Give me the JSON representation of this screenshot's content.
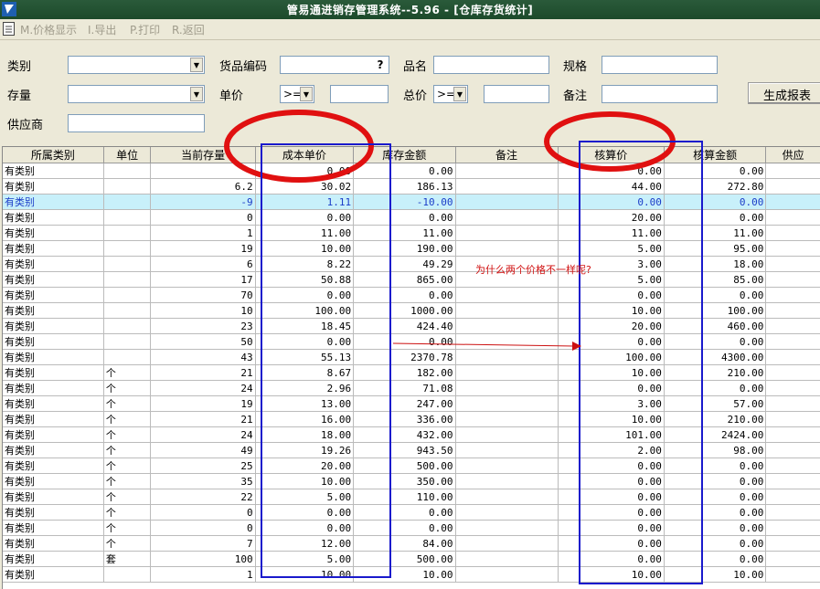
{
  "window": {
    "title": "管易通进销存管理系统--5.96 - [仓库存货统计]"
  },
  "toolbar": {
    "items": [
      {
        "label": "M.价格显示"
      },
      {
        "label": "I.导出"
      },
      {
        "label": "P.打印"
      },
      {
        "label": "R.返回"
      }
    ]
  },
  "form": {
    "category_label": "类别",
    "code_label": "货品编码",
    "code_button": "?",
    "name_label": "品名",
    "spec_label": "规格",
    "stock_label": "存量",
    "price_label": "单价",
    "price_op": ">=",
    "total_label": "总价",
    "total_op": ">=",
    "note_label": "备注",
    "supplier_label": "供应商",
    "generate_button": "生成报表"
  },
  "table": {
    "columns": [
      "所属类别",
      "单位",
      "当前存量",
      "成本单价",
      "库存金额",
      "备注",
      "核算价",
      "核算金额",
      "供应"
    ],
    "rows": [
      [
        "有类别",
        "",
        "",
        "0.00",
        "0.00",
        "",
        "0.00",
        "0.00",
        ""
      ],
      [
        "有类别",
        "",
        "6.2",
        "30.02",
        "186.13",
        "",
        "44.00",
        "272.80",
        ""
      ],
      [
        "有类别",
        "",
        "-9",
        "1.11",
        "-10.00",
        "",
        "0.00",
        "0.00",
        ""
      ],
      [
        "有类别",
        "",
        "0",
        "0.00",
        "0.00",
        "",
        "20.00",
        "0.00",
        ""
      ],
      [
        "有类别",
        "",
        "1",
        "11.00",
        "11.00",
        "",
        "11.00",
        "11.00",
        ""
      ],
      [
        "有类别",
        "",
        "19",
        "10.00",
        "190.00",
        "",
        "5.00",
        "95.00",
        ""
      ],
      [
        "有类别",
        "",
        "6",
        "8.22",
        "49.29",
        "",
        "3.00",
        "18.00",
        ""
      ],
      [
        "有类别",
        "",
        "17",
        "50.88",
        "865.00",
        "",
        "5.00",
        "85.00",
        ""
      ],
      [
        "有类别",
        "",
        "70",
        "0.00",
        "0.00",
        "",
        "0.00",
        "0.00",
        ""
      ],
      [
        "有类别",
        "",
        "10",
        "100.00",
        "1000.00",
        "",
        "10.00",
        "100.00",
        ""
      ],
      [
        "有类别",
        "",
        "23",
        "18.45",
        "424.40",
        "",
        "20.00",
        "460.00",
        ""
      ],
      [
        "有类别",
        "",
        "50",
        "0.00",
        "0.00",
        "",
        "0.00",
        "0.00",
        ""
      ],
      [
        "有类别",
        "",
        "43",
        "55.13",
        "2370.78",
        "",
        "100.00",
        "4300.00",
        ""
      ],
      [
        "有类别",
        "个",
        "21",
        "8.67",
        "182.00",
        "",
        "10.00",
        "210.00",
        ""
      ],
      [
        "有类别",
        "个",
        "24",
        "2.96",
        "71.08",
        "",
        "0.00",
        "0.00",
        ""
      ],
      [
        "有类别",
        "个",
        "19",
        "13.00",
        "247.00",
        "",
        "3.00",
        "57.00",
        ""
      ],
      [
        "有类别",
        "个",
        "21",
        "16.00",
        "336.00",
        "",
        "10.00",
        "210.00",
        ""
      ],
      [
        "有类别",
        "个",
        "24",
        "18.00",
        "432.00",
        "",
        "101.00",
        "2424.00",
        ""
      ],
      [
        "有类别",
        "个",
        "49",
        "19.26",
        "943.50",
        "",
        "2.00",
        "98.00",
        ""
      ],
      [
        "有类别",
        "个",
        "25",
        "20.00",
        "500.00",
        "",
        "0.00",
        "0.00",
        ""
      ],
      [
        "有类别",
        "个",
        "35",
        "10.00",
        "350.00",
        "",
        "0.00",
        "0.00",
        ""
      ],
      [
        "有类别",
        "个",
        "22",
        "5.00",
        "110.00",
        "",
        "0.00",
        "0.00",
        ""
      ],
      [
        "有类别",
        "个",
        "0",
        "0.00",
        "0.00",
        "",
        "0.00",
        "0.00",
        ""
      ],
      [
        "有类别",
        "个",
        "0",
        "0.00",
        "0.00",
        "",
        "0.00",
        "0.00",
        ""
      ],
      [
        "有类别",
        "个",
        "7",
        "12.00",
        "84.00",
        "",
        "0.00",
        "0.00",
        ""
      ],
      [
        "有类别",
        "套",
        "100",
        "5.00",
        "500.00",
        "",
        "0.00",
        "0.00",
        ""
      ],
      [
        "有类别",
        "",
        "1",
        "10.00",
        "10.00",
        "",
        "10.00",
        "10.00",
        ""
      ]
    ],
    "selected_row": 2
  },
  "annotation": {
    "note": "为什么两个价格不一样呢?",
    "circle_color": "#e01010",
    "box_color": "#1a1acc",
    "arrow_color": "#cc1010"
  }
}
